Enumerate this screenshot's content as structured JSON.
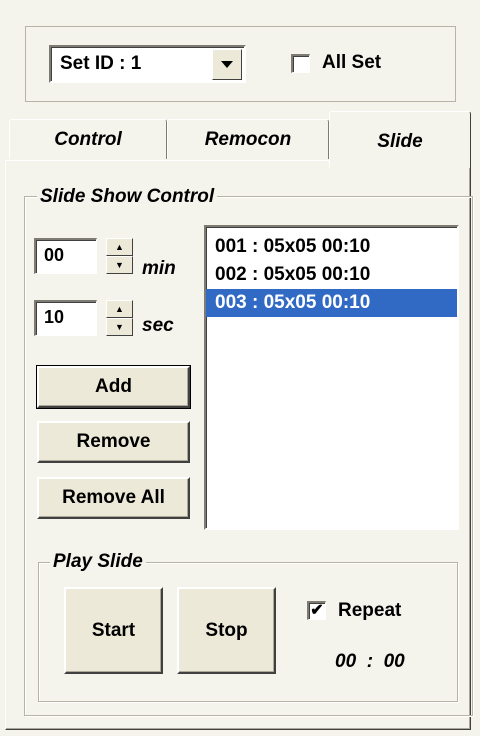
{
  "set_id": {
    "label": "Set ID :",
    "value": "1"
  },
  "all_set": {
    "label": "All Set",
    "checked": false
  },
  "tabs": [
    {
      "label": "Control",
      "active": false
    },
    {
      "label": "Remocon",
      "active": false
    },
    {
      "label": "Slide",
      "active": true
    }
  ],
  "slide_show": {
    "title": "Slide Show Control",
    "minutes": {
      "value": "00",
      "unit": "min"
    },
    "seconds": {
      "value": "10",
      "unit": "sec"
    },
    "spin_up": "▲",
    "spin_down": "▼",
    "buttons": {
      "add": "Add",
      "remove": "Remove",
      "remove_all": "Remove All"
    },
    "list": [
      {
        "text": "001 : 05x05  00:10",
        "selected": false
      },
      {
        "text": "002 : 05x05  00:10",
        "selected": false
      },
      {
        "text": "003 : 05x05  00:10",
        "selected": true
      }
    ]
  },
  "play": {
    "title": "Play Slide",
    "start": "Start",
    "stop": "Stop",
    "repeat": {
      "label": "Repeat",
      "checked": true,
      "mark": "✔"
    },
    "time": "00  :  00"
  },
  "colors": {
    "selection": "#316ac5",
    "background": "#f4f3ec"
  }
}
